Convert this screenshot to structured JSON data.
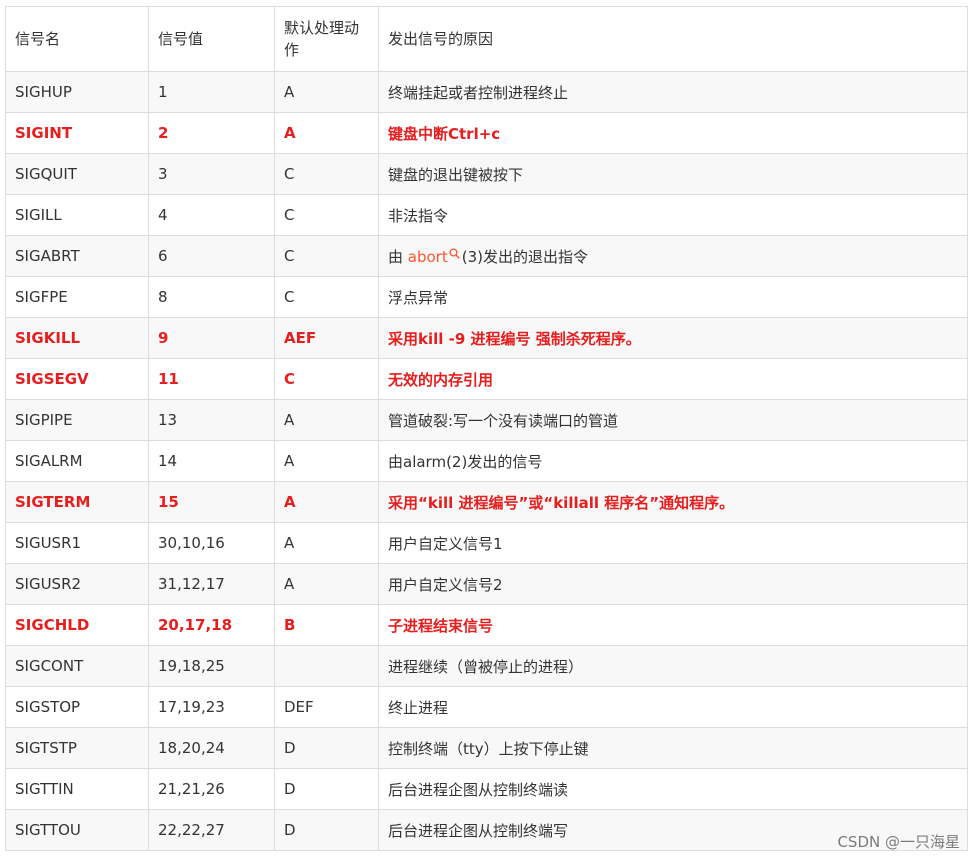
{
  "table": {
    "headers": [
      "信号名",
      "信号值",
      "默认处理动作",
      "发出信号的原因"
    ],
    "rows": [
      {
        "name": "SIGHUP",
        "value": "1",
        "action": "A",
        "reason": "终端挂起或者控制进程终止",
        "highlight": false
      },
      {
        "name": "SIGINT",
        "value": "2",
        "action": "A",
        "reason": "键盘中断Ctrl+c",
        "highlight": true
      },
      {
        "name": "SIGQUIT",
        "value": "3",
        "action": "C",
        "reason": "键盘的退出键被按下",
        "highlight": false
      },
      {
        "name": "SIGILL",
        "value": "4",
        "action": "C",
        "reason": "非法指令",
        "highlight": false
      },
      {
        "name": "SIGABRT",
        "value": "6",
        "action": "C",
        "reason_prefix": "由 ",
        "reason_link": "abort",
        "reason_suffix": "(3)发出的退出指令",
        "highlight": false
      },
      {
        "name": "SIGFPE",
        "value": "8",
        "action": "C",
        "reason": "浮点异常",
        "highlight": false
      },
      {
        "name": "SIGKILL",
        "value": "9",
        "action": "AEF",
        "reason": "采用kill   -9 进程编号 强制杀死程序。",
        "highlight": true
      },
      {
        "name": "SIGSEGV",
        "value": "11",
        "action": "C",
        "reason": "无效的内存引用",
        "highlight": true
      },
      {
        "name": "SIGPIPE",
        "value": "13",
        "action": "A",
        "reason": "管道破裂:写一个没有读端口的管道",
        "highlight": false
      },
      {
        "name": "SIGALRM",
        "value": "14",
        "action": "A",
        "reason": "由alarm(2)发出的信号",
        "highlight": false
      },
      {
        "name": "SIGTERM",
        "value": "15",
        "action": "A",
        "reason": "采用“kill   进程编号”或“killall 程序名”通知程序。",
        "highlight": true
      },
      {
        "name": "SIGUSR1",
        "value": "30,10,16",
        "action": "A",
        "reason": "用户自定义信号1",
        "highlight": false
      },
      {
        "name": "SIGUSR2",
        "value": "31,12,17",
        "action": "A",
        "reason": "用户自定义信号2",
        "highlight": false
      },
      {
        "name": "SIGCHLD",
        "value": "20,17,18",
        "action": "B",
        "reason": "子进程结束信号",
        "highlight": true
      },
      {
        "name": "SIGCONT",
        "value": "19,18,25",
        "action": "",
        "reason": "进程继续（曾被停止的进程）",
        "highlight": false
      },
      {
        "name": "SIGSTOP",
        "value": "17,19,23",
        "action": "DEF",
        "reason": "终止进程",
        "highlight": false
      },
      {
        "name": "SIGTSTP",
        "value": "18,20,24",
        "action": "D",
        "reason": "控制终端（tty）上按下停止键",
        "highlight": false
      },
      {
        "name": "SIGTTIN",
        "value": "21,21,26",
        "action": "D",
        "reason": "后台进程企图从控制终端读",
        "highlight": false
      },
      {
        "name": "SIGTTOU",
        "value": "22,22,27",
        "action": "D",
        "reason": "后台进程企图从控制终端写",
        "highlight": false
      }
    ]
  },
  "watermark": "CSDN @一只海星",
  "colors": {
    "highlight": "#e61e1e",
    "link": "#fc5531",
    "border": "#dddddd",
    "stripe": "#f8f8f8"
  }
}
